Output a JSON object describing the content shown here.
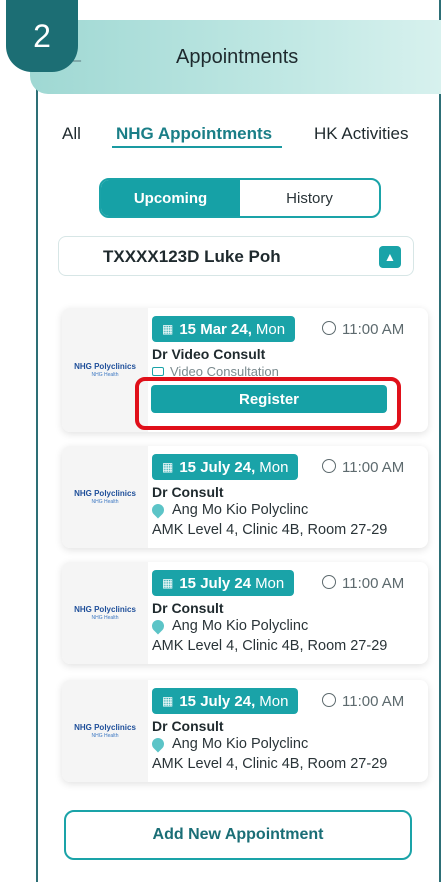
{
  "step_badge": "2",
  "header": {
    "title": "Appointments",
    "back_icon": "arrow-left-icon"
  },
  "tabs": [
    {
      "label": "All",
      "active": false
    },
    {
      "label": "NHG Appointments",
      "active": true
    },
    {
      "label": "HK Activities",
      "active": false
    }
  ],
  "segment": {
    "upcoming": "Upcoming",
    "history": "History",
    "selected": "Upcoming"
  },
  "patient": {
    "name": "TXXXX123D Luke Poh"
  },
  "logo": {
    "main": "NHG Polyclinics",
    "sub": "NHG Health"
  },
  "appointments": [
    {
      "date": "15 Mar 24,",
      "day": "Mon",
      "time": "11:00 AM",
      "doctor": "Dr Video Consult",
      "mode": "Video Consultation",
      "action": "Register"
    },
    {
      "date": "15 July 24,",
      "day": "Mon",
      "time": "11:00 AM",
      "doctor": "Dr Consult",
      "location": "Ang Mo Kio Polyclinc",
      "address": "AMK Level 4, Clinic 4B, Room 27-29"
    },
    {
      "date": "15 July 24",
      "day": "Mon",
      "time": "11:00 AM",
      "doctor": "Dr Consult",
      "location": "Ang Mo Kio Polyclinc",
      "address": "AMK Level 4, Clinic 4B, Room 27-29"
    },
    {
      "date": "15 July 24,",
      "day": "Mon",
      "time": "11:00 AM",
      "doctor": "Dr Consult",
      "location": "Ang Mo Kio Polyclinc",
      "address": "AMK Level 4, Clinic 4B, Room 27-29"
    }
  ],
  "add_button": "Add New Appointment",
  "colors": {
    "accent": "#16a1a6",
    "highlight": "#e0101a",
    "badge": "#1c6e74"
  }
}
